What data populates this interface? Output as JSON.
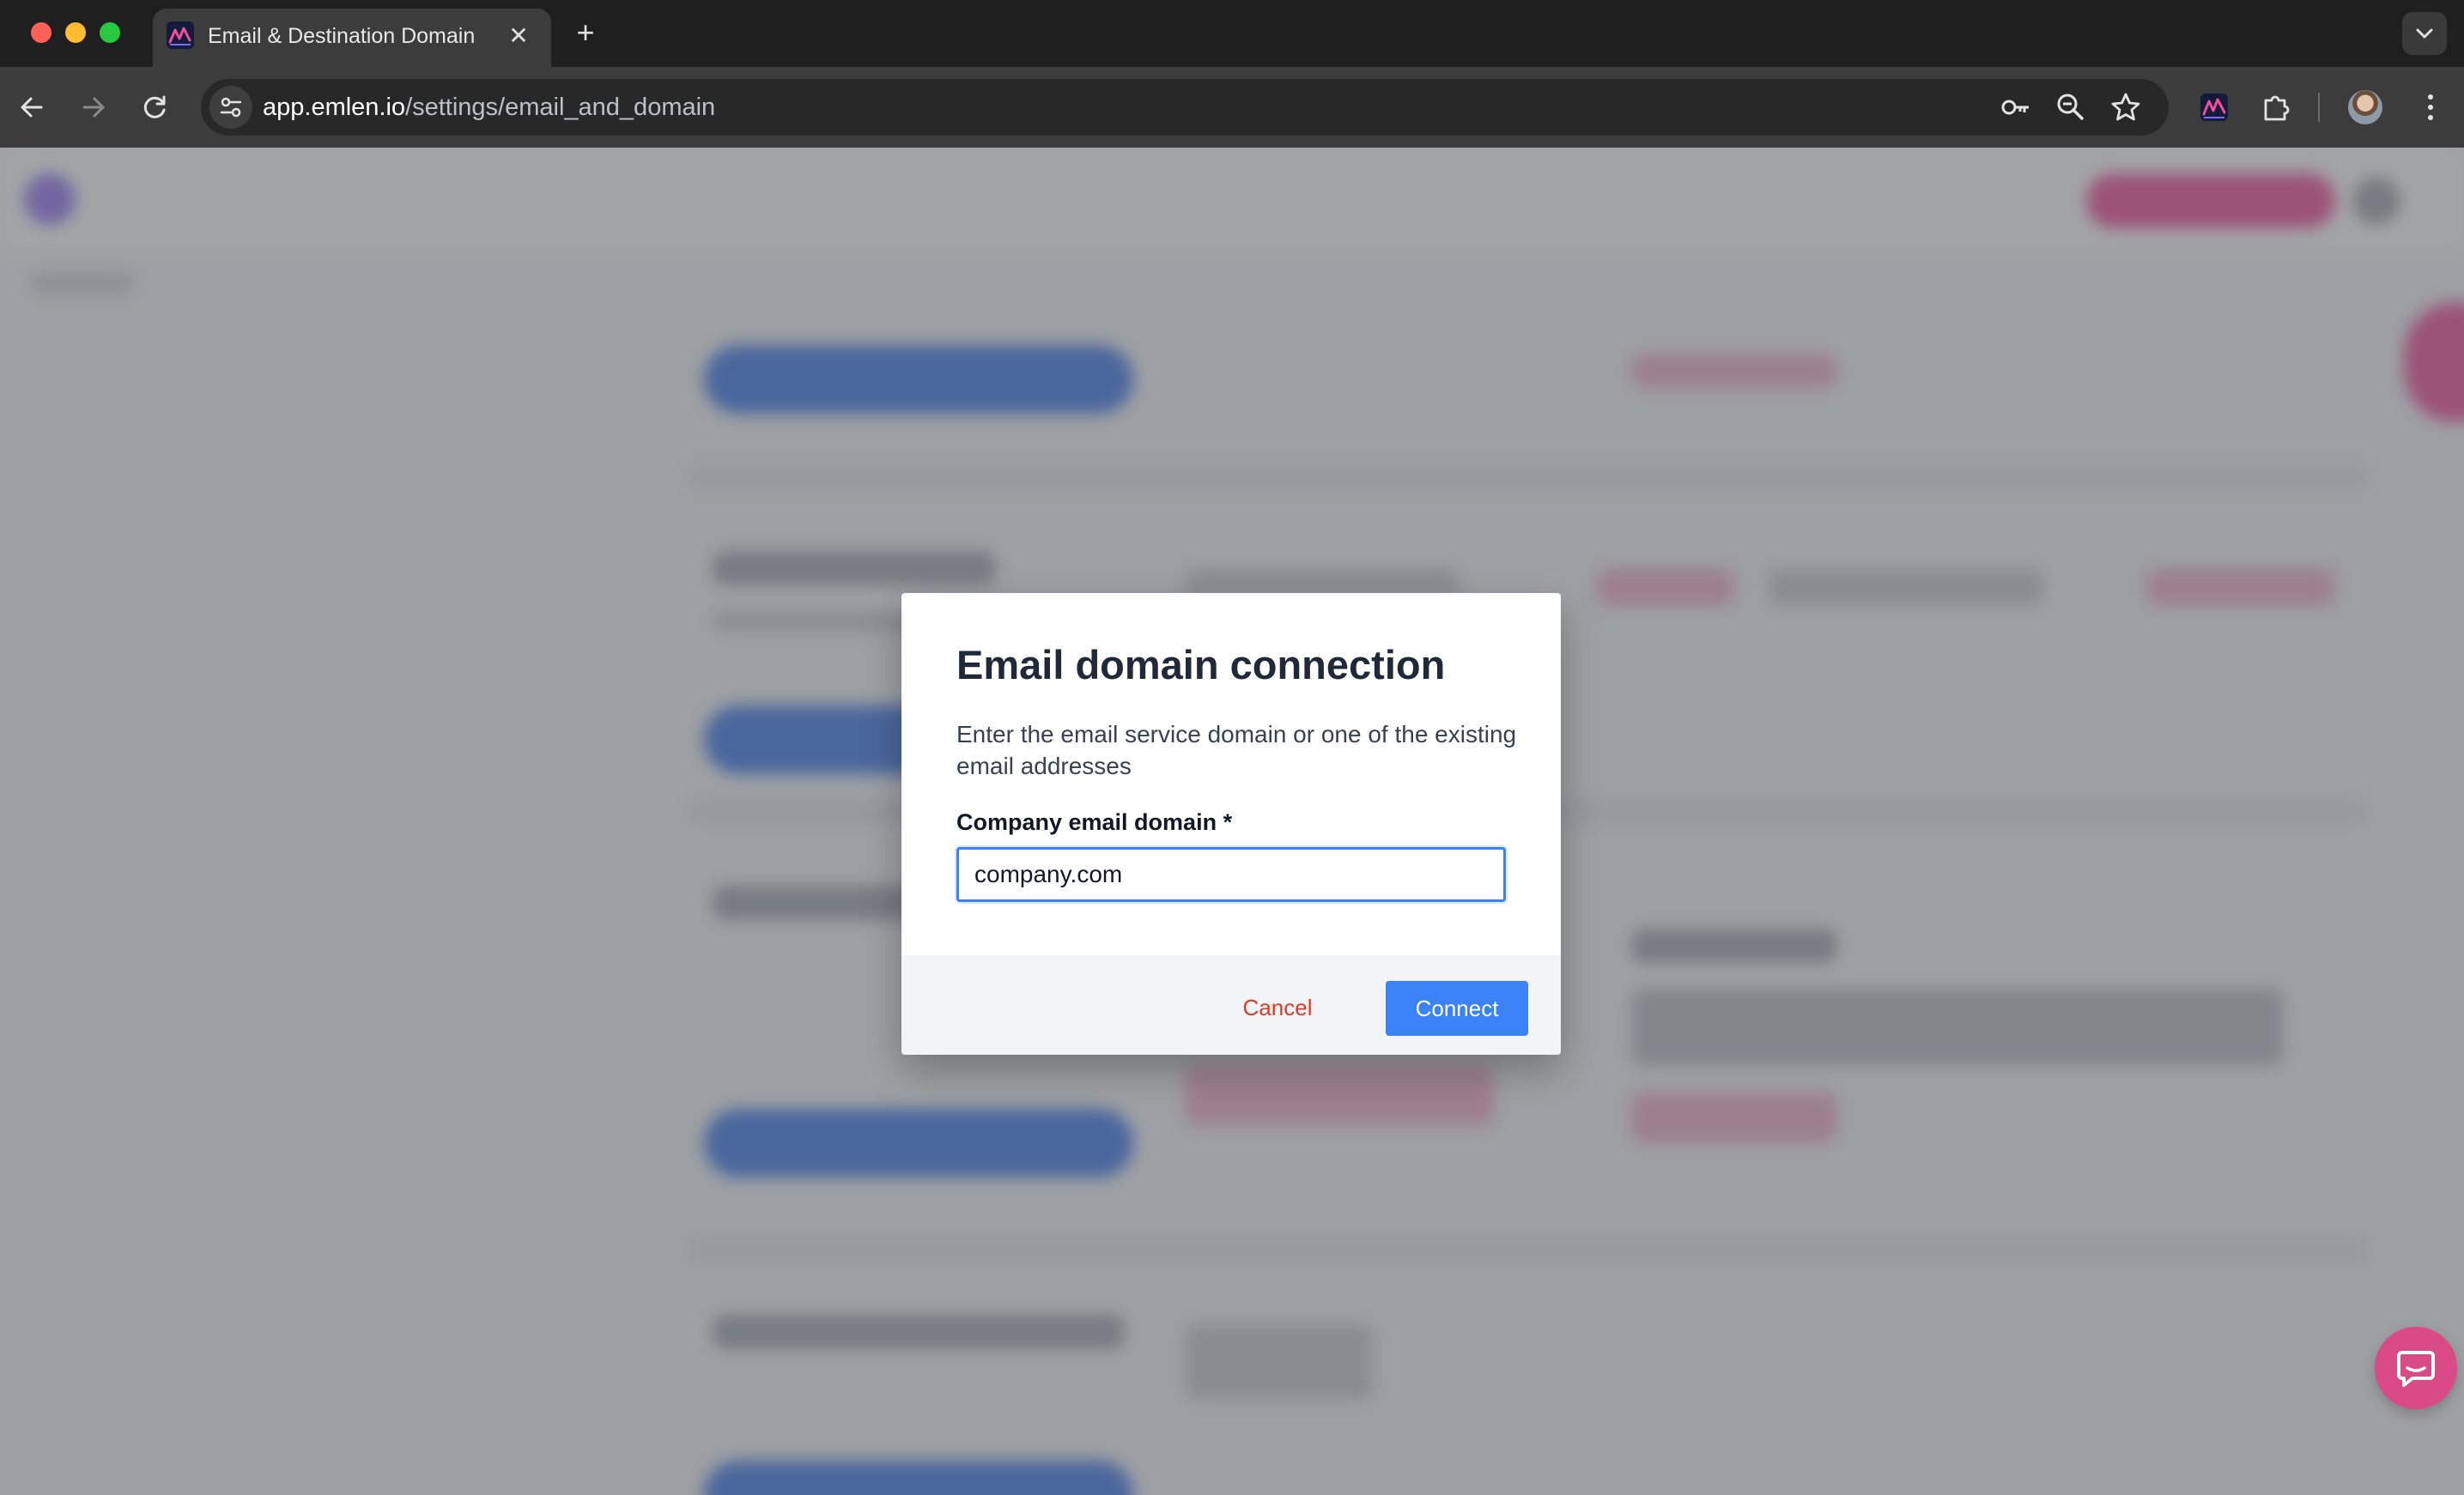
{
  "browser": {
    "tab_title": "Email & Destination Domain | ",
    "new_tab_symbol": "+",
    "close_symbol": "✕",
    "url_host": "app.emlen.io",
    "url_path": "/settings/email_and_domain"
  },
  "modal": {
    "title": "Email domain connection",
    "description": "Enter the email service domain or one of the existing email addresses",
    "field_label": "Company email domain",
    "required_marker": "*",
    "field_value": "company.com",
    "cancel_label": "Cancel",
    "connect_label": "Connect"
  },
  "icons": {
    "tab_favicon": "emlen-logo-icon",
    "back": "back-arrow-icon",
    "forward": "forward-arrow-icon",
    "reload": "reload-icon",
    "site_info": "site-settings-icon",
    "password": "key-icon",
    "zoom": "zoom-out-icon",
    "bookmark": "star-icon",
    "extension_app": "emlen-extension-icon",
    "extensions": "puzzle-icon",
    "profile": "avatar",
    "menu": "kebab-menu-icon",
    "tab_search": "chevron-down-icon",
    "chat": "chat-icon"
  },
  "colors": {
    "primary_button": "#3b82f6",
    "cancel_text": "#dc3b2b",
    "chat_bubble": "#d94a86",
    "overlay": "rgba(95,98,104,0.58)"
  }
}
